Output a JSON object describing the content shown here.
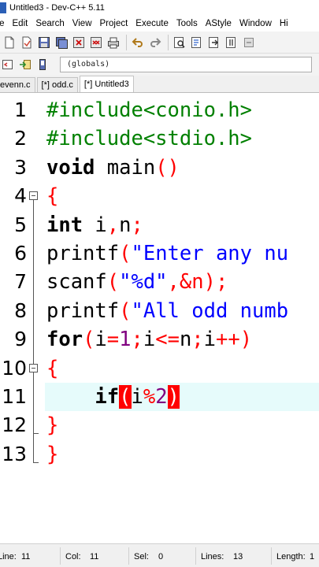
{
  "window": {
    "title": "Untitled3 - Dev-C++ 5.11"
  },
  "menubar": [
    "ile",
    "Edit",
    "Search",
    "View",
    "Project",
    "Execute",
    "Tools",
    "AStyle",
    "Window",
    "Hi"
  ],
  "toolbar": {
    "row1_icons": [
      "new-file-icon",
      "open-file-icon",
      "save-icon",
      "save-all-icon",
      "close-icon",
      "close-all-icon",
      "print-icon",
      "undo-icon",
      "redo-icon",
      "find-icon",
      "replace-icon",
      "find-next-icon",
      "goto-icon",
      "collapse-icon"
    ],
    "row2_icons": [
      "new-class-icon",
      "insert-icon",
      "toggle-icon"
    ],
    "scope_value": "(globals)"
  },
  "tabs": [
    {
      "label": "evenn.c",
      "active": false
    },
    {
      "label": "[*] odd.c",
      "active": false
    },
    {
      "label": "[*] Untitled3",
      "active": true
    }
  ],
  "editor": {
    "current_line": 11,
    "lines": [
      {
        "n": "1",
        "fold": "none"
      },
      {
        "n": "2",
        "fold": "none"
      },
      {
        "n": "3",
        "fold": "none"
      },
      {
        "n": "4",
        "fold": "start"
      },
      {
        "n": "5",
        "fold": "mid"
      },
      {
        "n": "6",
        "fold": "mid"
      },
      {
        "n": "7",
        "fold": "mid"
      },
      {
        "n": "8",
        "fold": "mid"
      },
      {
        "n": "9",
        "fold": "mid"
      },
      {
        "n": "10",
        "fold": "start2"
      },
      {
        "n": "11",
        "fold": "mid"
      },
      {
        "n": "12",
        "fold": "end"
      },
      {
        "n": "13",
        "fold": "end"
      }
    ],
    "code": {
      "l1": {
        "pp": "#include<conio.h>"
      },
      "l2": {
        "pp": "#include<stdio.h>"
      },
      "l3": {
        "kw": "void",
        "fn": " main",
        "p": "()"
      },
      "l4": {
        "brace": "{"
      },
      "l5": {
        "kw": "int",
        "a": " i",
        "c": ",",
        "b": "n",
        "s": ";"
      },
      "l6": {
        "fn": "printf",
        "p": "(",
        "str": "\"Enter any nu"
      },
      "l7": {
        "fn": "scanf",
        "p": "(",
        "str": "\"%d\"",
        "rest": ",&n",
        "p2": ");"
      },
      "l8": {
        "fn": "printf",
        "p": "(",
        "str": "\"All odd numb"
      },
      "l9": {
        "kw": "for",
        "p": "(",
        "a": "i",
        "eq": "=",
        "num": "1",
        "s1": ";",
        "b": "i",
        "le": "<=",
        "c": "n",
        "s2": ";",
        "d": "i",
        "inc": "++",
        "p2": ")"
      },
      "l10": {
        "brace": "{"
      },
      "l11": {
        "indent": "    ",
        "kw": "if",
        "po": "(",
        "a": "i",
        "mod": "%",
        "num": "2",
        "pc": ")"
      },
      "l12": {
        "brace": "}"
      },
      "l13": {
        "brace": "}"
      }
    }
  },
  "statusbar": {
    "line_label": "Line:",
    "line_value": "11",
    "col_label": "Col:",
    "col_value": "11",
    "sel_label": "Sel:",
    "sel_value": "0",
    "lines_label": "Lines:",
    "lines_value": "13",
    "length_label": "Length:",
    "length_value": "1"
  },
  "colors": {
    "keyword": "#000000",
    "preprocessor": "#008000",
    "string": "#0000ff",
    "number": "#800080",
    "operator": "#ff0000",
    "current_line": "#e6fbfb"
  }
}
